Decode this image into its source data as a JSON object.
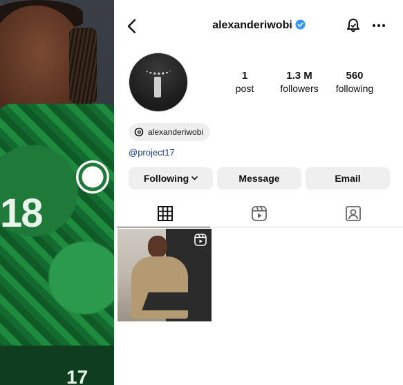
{
  "profile": {
    "username": "alexanderiwobi",
    "verified": true,
    "stats": {
      "posts": {
        "value": "1",
        "label": "post"
      },
      "followers": {
        "value": "1.3 M",
        "label": "followers"
      },
      "following": {
        "value": "560",
        "label": "following"
      }
    },
    "threads_handle": "alexanderiwobi",
    "bio_link": "@project17"
  },
  "actions": {
    "following_label": "Following",
    "message_label": "Message",
    "email_label": "Email"
  },
  "tabs": [
    {
      "icon": "grid-icon",
      "active": true
    },
    {
      "icon": "reels-icon",
      "active": false
    },
    {
      "icon": "tagged-icon",
      "active": false
    }
  ],
  "posts": [
    {
      "type": "reel",
      "icon": "reel-badge-icon"
    }
  ],
  "left_photo": {
    "jersey_number": "18",
    "shorts_number": "17"
  },
  "colors": {
    "verified_badge": "#3897f0",
    "link": "#1b3f8c",
    "button_bg": "#efefef",
    "jersey_green": "#1d8a3e"
  },
  "icons": {
    "back": "chevron-left-icon",
    "verified": "verified-badge-icon",
    "notifications": "bell-icon",
    "more": "more-horizontal-icon",
    "threads": "threads-icon",
    "dropdown": "chevron-down-icon"
  }
}
